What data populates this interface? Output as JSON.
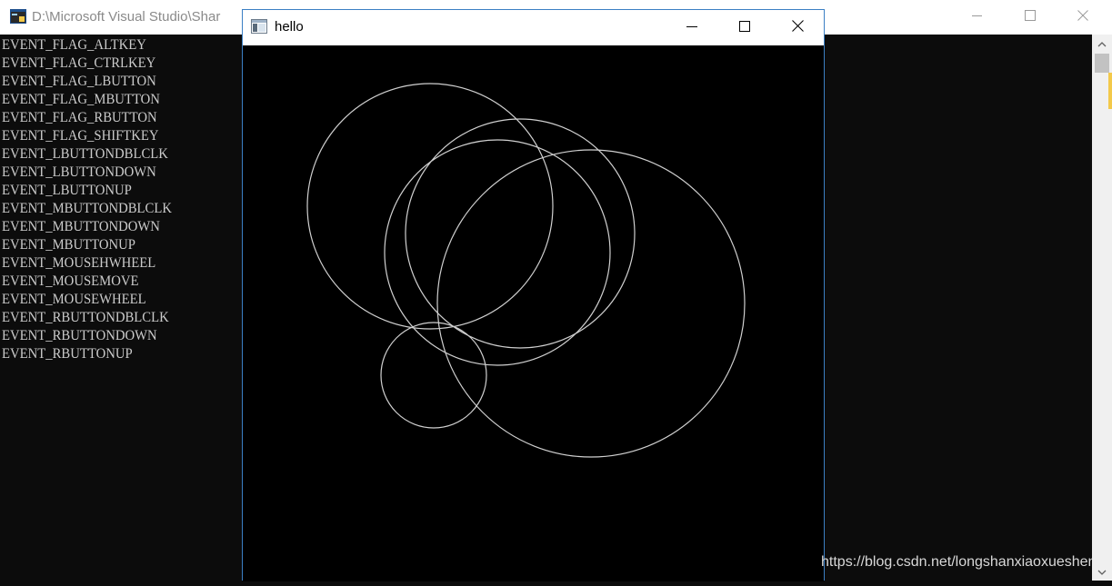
{
  "console": {
    "title": "D:\\Microsoft Visual Studio\\Shar",
    "lines": [
      "EVENT_FLAG_ALTKEY",
      "EVENT_FLAG_CTRLKEY",
      "EVENT_FLAG_LBUTTON",
      "EVENT_FLAG_MBUTTON",
      "EVENT_FLAG_RBUTTON",
      "EVENT_FLAG_SHIFTKEY",
      "EVENT_LBUTTONDBLCLK",
      "EVENT_LBUTTONDOWN",
      "EVENT_LBUTTONUP",
      "EVENT_MBUTTONDBLCLK",
      "EVENT_MBUTTONDOWN",
      "EVENT_MBUTTONUP",
      "EVENT_MOUSEHWHEEL",
      "EVENT_MOUSEMOVE",
      "EVENT_MOUSEWHEEL",
      "EVENT_RBUTTONDBLCLK",
      "EVENT_RBUTTONDOWN",
      "EVENT_RBUTTONUP"
    ],
    "icons": {
      "app": "console-app-icon",
      "minimize": "minimize-icon",
      "maximize": "maximize-icon",
      "close": "close-icon"
    }
  },
  "hello_window": {
    "title": "hello",
    "icons": {
      "app": "window-app-icon",
      "minimize": "minimize-icon",
      "maximize": "maximize-icon",
      "close": "close-icon"
    },
    "canvas": {
      "background": "#000000",
      "stroke_color": "#d0d0d0",
      "shapes": "circles",
      "circle_count": 5
    }
  },
  "watermark": "https://blog.csdn.net/longshanxiaoxueshen",
  "colors": {
    "console_bg": "#0c0c0c",
    "console_text": "#cccccc",
    "window_border": "#3b7fc4"
  }
}
